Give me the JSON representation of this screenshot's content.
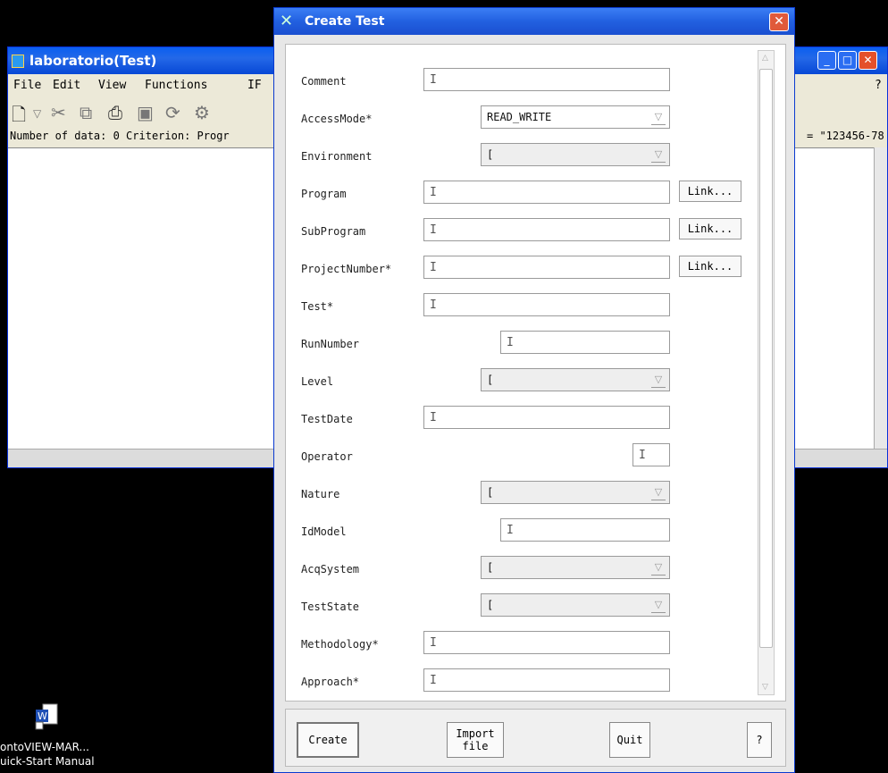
{
  "background_window": {
    "title": "laboratorio(Test)",
    "menu": [
      "File",
      "Edit",
      "View",
      "Functions",
      "IF"
    ],
    "help_menu": "?",
    "status_left": "Number of data: 0 Criterion: Progr",
    "status_right": "= \"123456-78"
  },
  "dialog": {
    "title": "Create Test",
    "fields": [
      {
        "label": "Comment",
        "type": "text",
        "value": ""
      },
      {
        "label": "AccessMode*",
        "type": "combo",
        "value": "READ_WRITE"
      },
      {
        "label": "Environment",
        "type": "combo",
        "value": ""
      },
      {
        "label": "Program",
        "type": "text",
        "value": "",
        "link": "Link..."
      },
      {
        "label": "SubProgram",
        "type": "text",
        "value": "",
        "link": "Link..."
      },
      {
        "label": "ProjectNumber*",
        "type": "text",
        "value": "",
        "link": "Link..."
      },
      {
        "label": "Test*",
        "type": "text",
        "value": ""
      },
      {
        "label": "RunNumber",
        "type": "text",
        "value": ""
      },
      {
        "label": "Level",
        "type": "combo",
        "value": ""
      },
      {
        "label": "TestDate",
        "type": "text",
        "value": ""
      },
      {
        "label": "Operator",
        "type": "text",
        "value": ""
      },
      {
        "label": "Nature",
        "type": "combo",
        "value": ""
      },
      {
        "label": "IdModel",
        "type": "text",
        "value": ""
      },
      {
        "label": "AcqSystem",
        "type": "combo",
        "value": ""
      },
      {
        "label": "TestState",
        "type": "combo",
        "value": ""
      },
      {
        "label": "Methodology*",
        "type": "text",
        "value": ""
      },
      {
        "label": "Approach*",
        "type": "text",
        "value": ""
      }
    ],
    "buttons": {
      "create": "Create",
      "import_line1": "Import",
      "import_line2": "file",
      "quit": "Quit",
      "help": "?"
    }
  },
  "desktop_icon": {
    "line1": "ontoVIEW-MAR...",
    "line2": "uick-Start Manual"
  }
}
